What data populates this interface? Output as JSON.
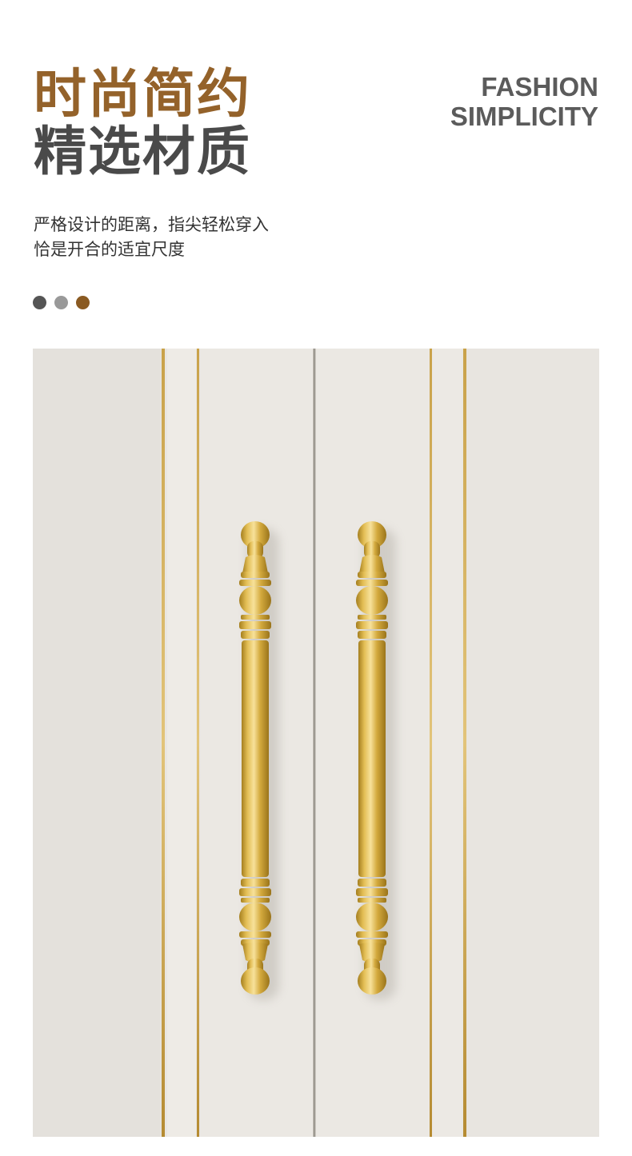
{
  "title": {
    "cn_line1": "时尚简约",
    "cn_line2": "精选材质",
    "en_line1": "FASHION",
    "en_line2": "SIMPLICITY"
  },
  "description": {
    "line1": "严格设计的距离，指尖轻松穿入",
    "line2": "恰是开合的适宜尺度"
  },
  "color_swatches": [
    "#555555",
    "#999999",
    "#8a5a22"
  ],
  "colors": {
    "accent_brown": "#94622a",
    "dark_gray": "#4a4a4a",
    "cabinet_white": "#ebe8e3",
    "brass": "#d4ab3e"
  },
  "photo": {
    "subject": "brass-cabinet-handles-on-white-doors"
  }
}
